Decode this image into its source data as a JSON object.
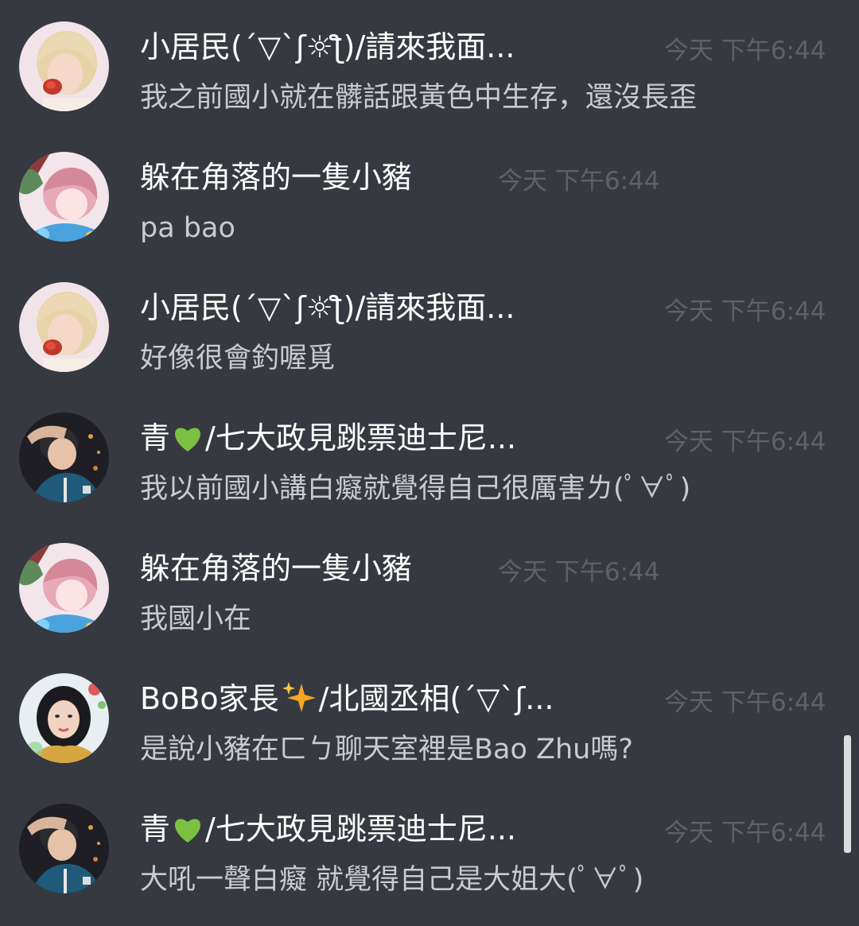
{
  "colors": {
    "background": "#36393f",
    "username": "#ffffff",
    "message_text": "#c9cbcf",
    "timestamp": "#5e6168",
    "heart": "#7bc043",
    "sparkle": "#f5a623"
  },
  "messages": [
    {
      "username": "小居民(´▽`ʃ☼ƪ)/請來我面...",
      "timestamp": "今天 下午6:44",
      "text": "我之前國小就在髒話跟黃色中生存，還沒長歪",
      "avatar": "blonde-woman-avatar"
    },
    {
      "username": "躲在角落的一隻小豬",
      "timestamp": "今天 下午6:44",
      "text": "pa bao",
      "avatar": "anime-girl-avatar"
    },
    {
      "username": "小居民(´▽`ʃ☼ƪ)/請來我面...",
      "timestamp": "今天 下午6:44",
      "text": "好像很會釣喔覓",
      "avatar": "blonde-woman-avatar"
    },
    {
      "username_prefix": "青",
      "username_suffix": "/七大政見跳票迪士尼...",
      "username_icon": "green-heart-icon",
      "timestamp": "今天 下午6:44",
      "text": "我以前國小講白癡就覺得自己很厲害ㄌ(ﾟ∀ﾟ)",
      "avatar": "boy-photo-avatar"
    },
    {
      "username": "躲在角落的一隻小豬",
      "timestamp": "今天 下午6:44",
      "text": "我國小在",
      "avatar": "anime-girl-avatar"
    },
    {
      "username_prefix": "BoBo家長",
      "username_suffix": "/北國丞相(´▽`ʃ...",
      "username_icon": "sparkles-icon",
      "timestamp": "今天 下午6:44",
      "text": "是說小豬在ㄈㄅ聊天室裡是Bao Zhu嗎?",
      "avatar": "dark-hair-woman-avatar"
    },
    {
      "username_prefix": "青",
      "username_suffix": "/七大政見跳票迪士尼...",
      "username_icon": "green-heart-icon",
      "timestamp": "今天 下午6:44",
      "text": "大吼一聲白癡 就覺得自己是大姐大(ﾟ∀ﾟ)",
      "avatar": "boy-photo-avatar"
    }
  ]
}
